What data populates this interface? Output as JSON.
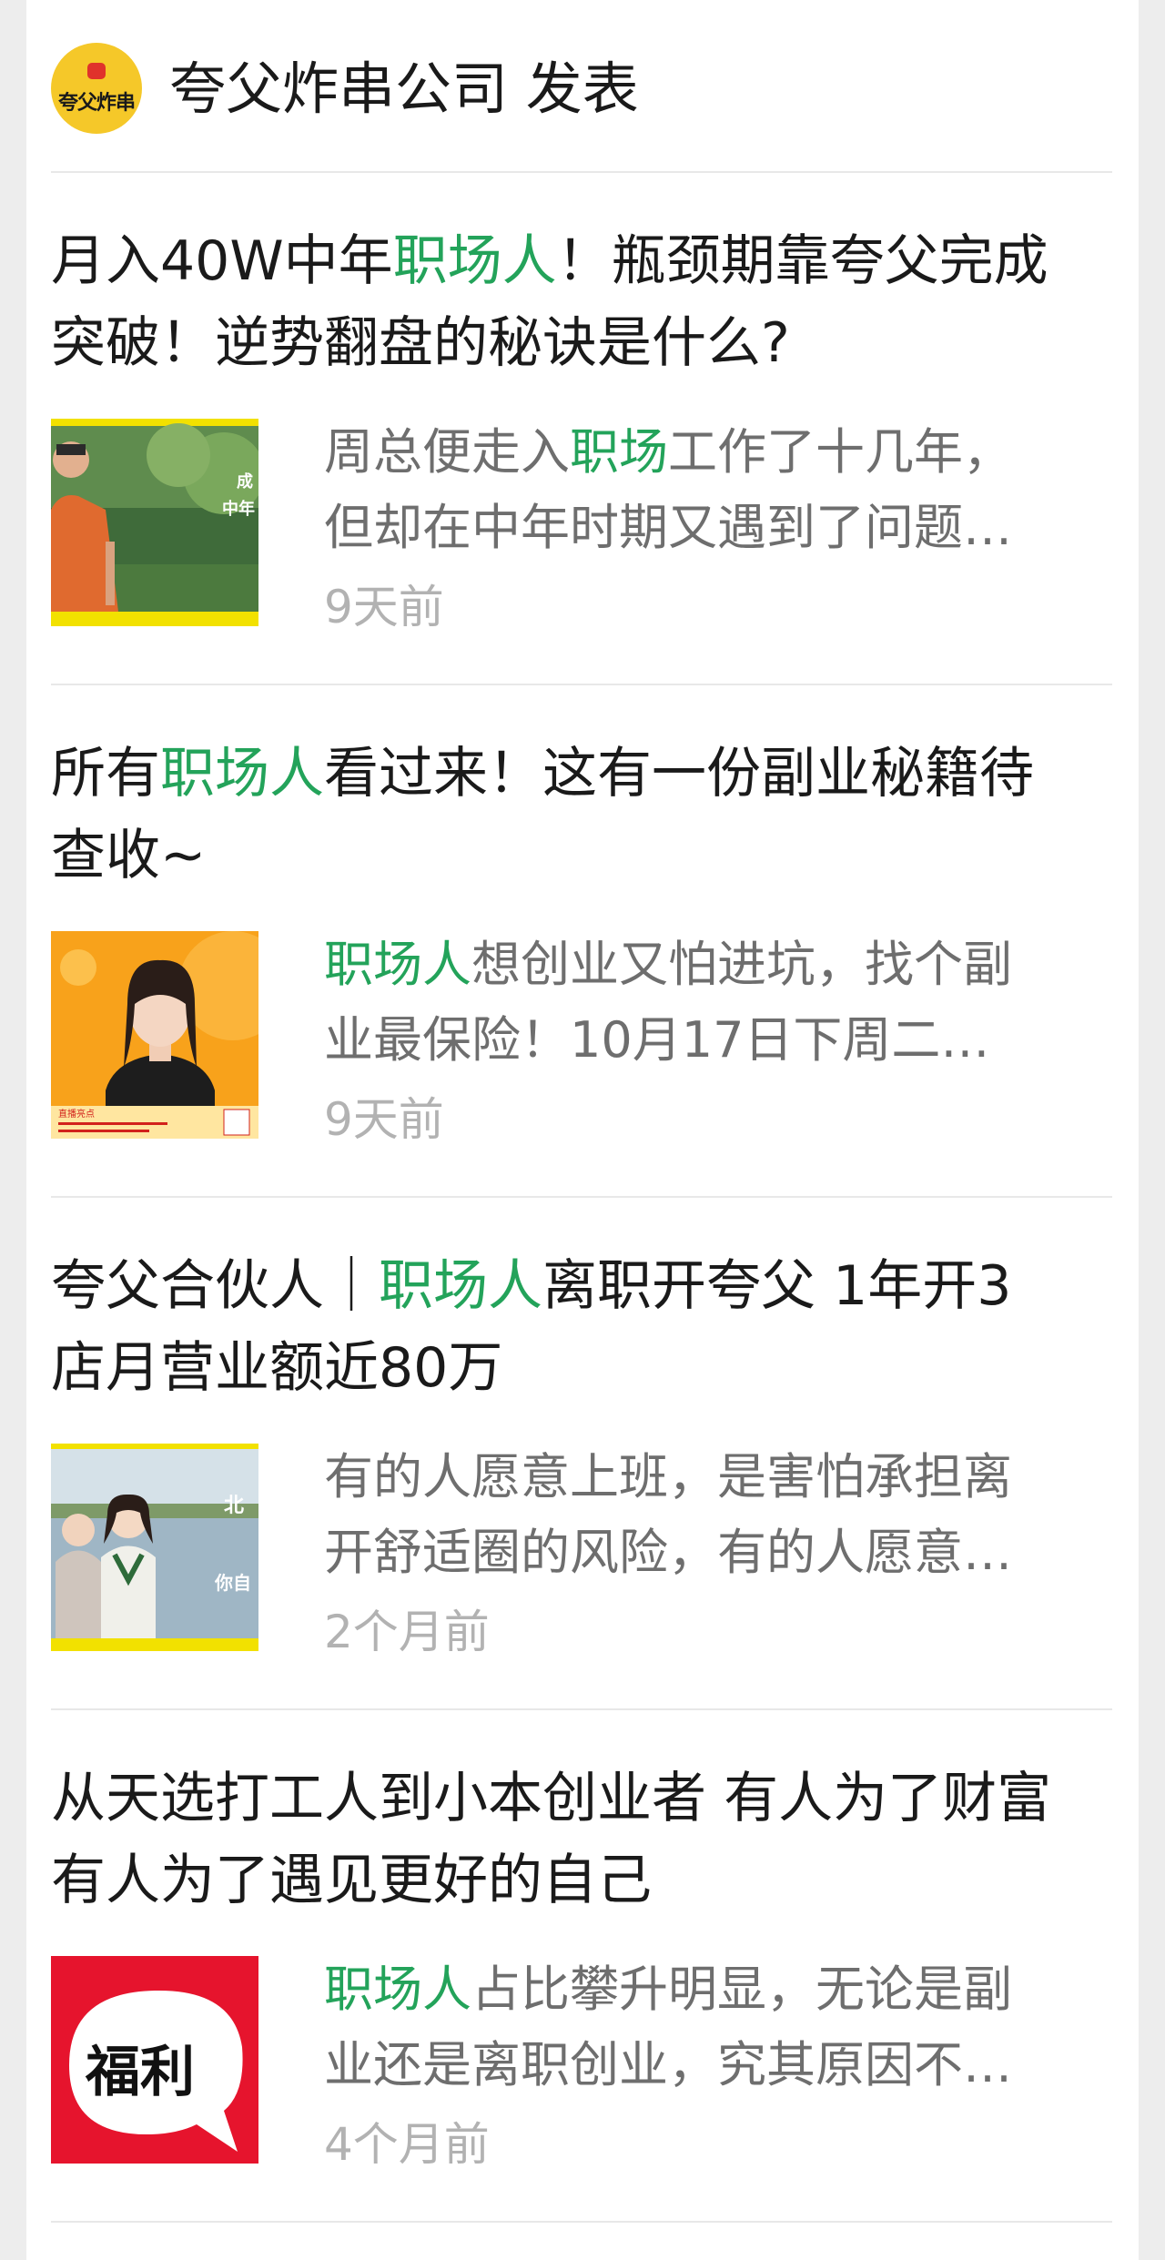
{
  "header": {
    "avatar_text": "夸父炸串",
    "publisher": "夸父炸串公司 发表"
  },
  "articles": [
    {
      "title_pre": "月入40W中年",
      "title_hl": "职场人",
      "title_post": "！瓶颈期靠夸父完成突破！逆势翻盘的秘诀是什么?",
      "sum1_hl": "",
      "sum1_pre": "周总便走入",
      "sum1_mid": "职场",
      "sum1_post": "工作了十几年，",
      "sum2": "但却在中年时期又遇到了问题…",
      "time": "9天前",
      "thumb_text": "成\n中年"
    },
    {
      "title_pre": "所有",
      "title_hl": "职场人",
      "title_post": "看过来！这有一份副业秘籍待查收~",
      "sum1_hl": "职场人",
      "sum1_pre": "",
      "sum1_mid": "",
      "sum1_post": "想创业又怕进坑，找个副",
      "sum2": "业最保险！10月17日下周二…",
      "time": "9天前",
      "thumb_text": "直播亮点"
    },
    {
      "title_pre": "夸父合伙人｜",
      "title_hl": "职场人",
      "title_post": "离职开夸父 1年开3店月营业额近80万",
      "sum1_hl": "",
      "sum1_pre": "有的人愿意上班，是害怕承担离",
      "sum1_mid": "",
      "sum1_post": "",
      "sum2": "开舒适圈的风险，有的人愿意…",
      "time": "2个月前",
      "thumb_text": "你自"
    },
    {
      "title_pre": "从天选打工人到小本创业者 有人为了财富 有人为了遇见更好的自己",
      "title_hl": "",
      "title_post": "",
      "sum1_hl": "职场人",
      "sum1_pre": "",
      "sum1_mid": "",
      "sum1_post": "占比攀升明显，无论是副",
      "sum2": "业还是离职创业，究其原因不…",
      "time": "4个月前",
      "thumb_text": "福利"
    }
  ]
}
